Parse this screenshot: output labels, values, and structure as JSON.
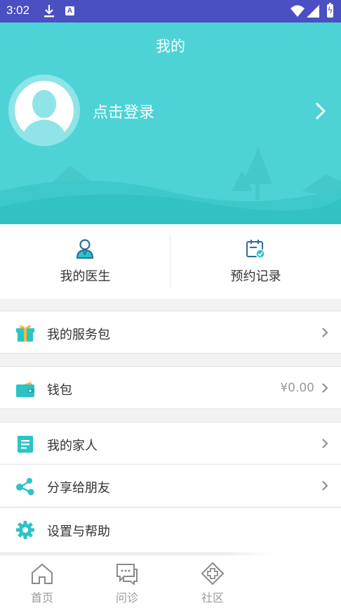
{
  "status_bar": {
    "time": "3:02",
    "notification_letter": "A"
  },
  "header": {
    "title": "我的",
    "login_text": "点击登录"
  },
  "quick_actions": [
    {
      "label": "我的医生",
      "icon": "doctor-icon"
    },
    {
      "label": "预约记录",
      "icon": "calendar-icon"
    }
  ],
  "menu": {
    "service_package": {
      "label": "我的服务包",
      "icon": "gift-icon"
    },
    "wallet": {
      "label": "钱包",
      "value": "¥0.00",
      "icon": "wallet-icon"
    },
    "family": {
      "label": "我的家人",
      "icon": "document-icon"
    },
    "share": {
      "label": "分享给朋友",
      "icon": "share-icon"
    },
    "settings": {
      "label": "设置与帮助",
      "icon": "gear-icon"
    }
  },
  "tabs": [
    {
      "label": "首页",
      "icon": "home-icon"
    },
    {
      "label": "问诊",
      "icon": "chat-icon"
    },
    {
      "label": "社区",
      "icon": "community-icon"
    }
  ],
  "colors": {
    "accent": "#4dd3d6",
    "status_bar": "#4a4fc1",
    "icon": "#2cc3c6"
  }
}
